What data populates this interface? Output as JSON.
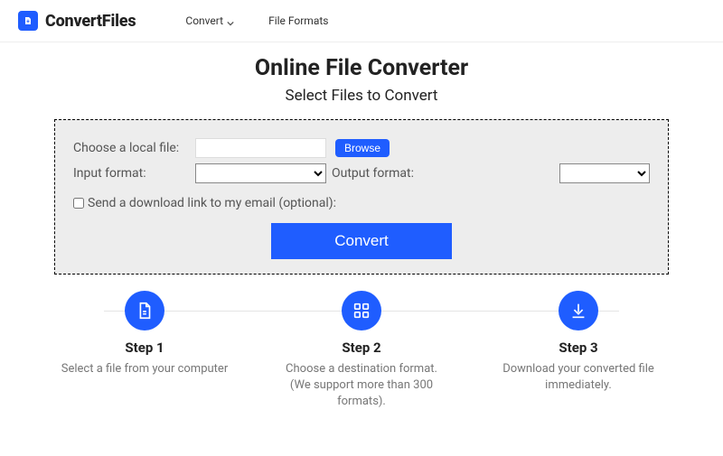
{
  "header": {
    "brand": "ConvertFiles",
    "nav": {
      "convert": "Convert",
      "formats": "File Formats"
    }
  },
  "main": {
    "title": "Online File Converter",
    "subtitle": "Select Files to Convert"
  },
  "form": {
    "choose_label": "Choose a local file:",
    "file_value": "",
    "browse_label": "Browse",
    "input_format_label": "Input format:",
    "input_format_value": "",
    "output_format_label": "Output format:",
    "output_format_value": "",
    "email_opt_label": "Send a download link to my email (optional):",
    "convert_label": "Convert"
  },
  "steps": [
    {
      "title": "Step 1",
      "desc": "Select a file from your computer"
    },
    {
      "title": "Step 2",
      "desc": "Choose a destination format. (We support more than 300 formats)."
    },
    {
      "title": "Step 3",
      "desc": "Download your converted file immediately."
    }
  ]
}
